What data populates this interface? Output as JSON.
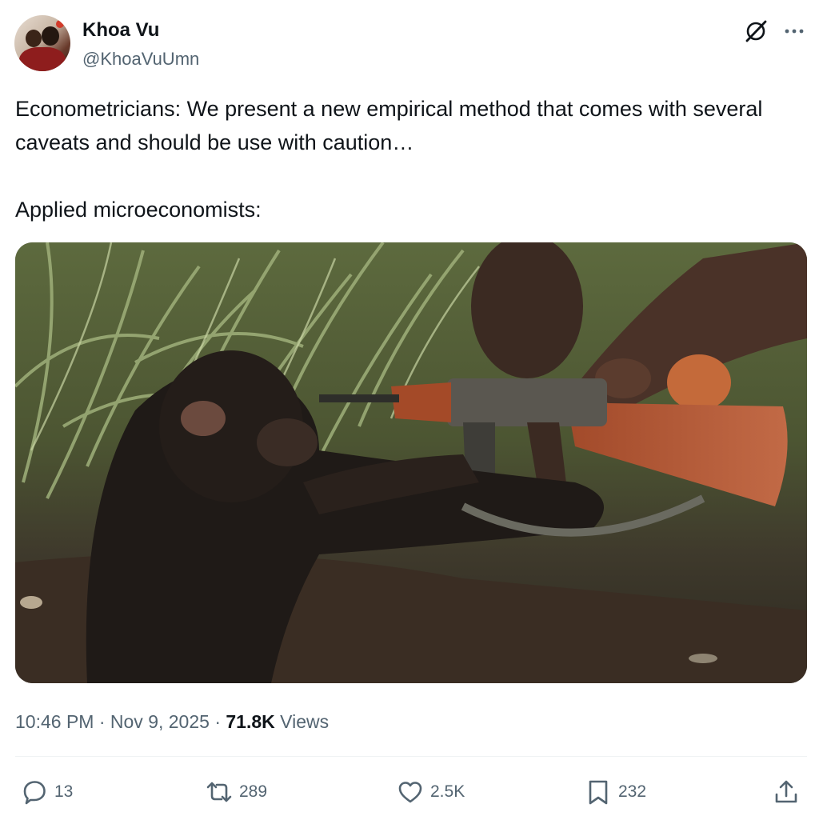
{
  "author": {
    "name": "Khoa Vu",
    "handle": "@KhoaVuUmn"
  },
  "tweet": {
    "line1": "Econometricians: We present a new empirical method that comes with several caveats and should be use with caution…",
    "line2": "Applied microeconomists:"
  },
  "meta": {
    "time": "10:46 PM",
    "sep1": " · ",
    "date": "Nov 9, 2025",
    "sep2": " · ",
    "views_count": "71.8K",
    "views_label": " Views"
  },
  "actions": {
    "replies": "13",
    "reposts": "289",
    "likes": "2.5K",
    "bookmarks": "232"
  },
  "icons": {
    "top_right": [
      "grok-icon",
      "more-icon"
    ],
    "bar": [
      "reply-icon",
      "repost-icon",
      "like-icon",
      "bookmark-icon",
      "share-icon"
    ]
  },
  "colors": {
    "text": "#0f1419",
    "secondary": "#536471",
    "divider": "#eff3f4"
  }
}
